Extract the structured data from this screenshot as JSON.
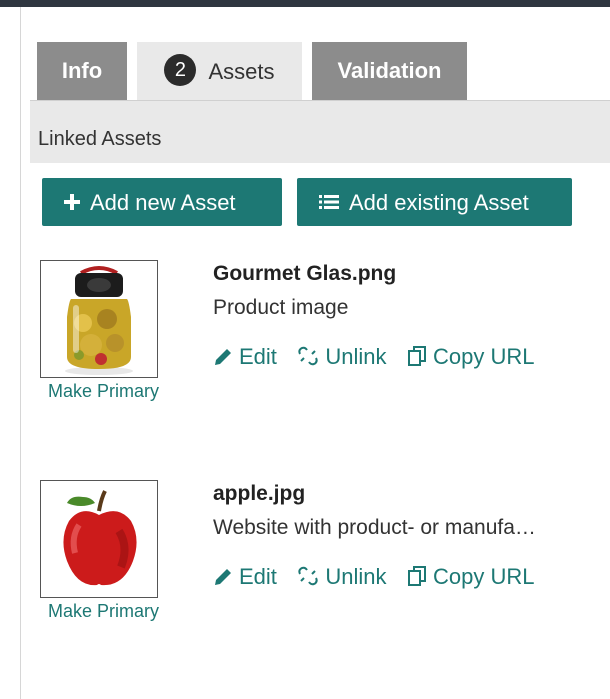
{
  "tabs": {
    "info_label": "Info",
    "assets_count": "2",
    "assets_label": "Assets",
    "validation_label": "Validation"
  },
  "section": {
    "title": "Linked Assets"
  },
  "buttons": {
    "add_new": "Add new Asset",
    "add_existing": "Add existing Asset"
  },
  "assets": [
    {
      "name": "Gourmet Glas.png",
      "description": "Product image",
      "edit": "Edit",
      "unlink": "Unlink",
      "copy_url": "Copy URL",
      "make_primary": "Make Primary",
      "thumbnail_icon": "jar-image"
    },
    {
      "name": "apple.jpg",
      "description": "Website with product- or manufa…",
      "edit": "Edit",
      "unlink": "Unlink",
      "copy_url": "Copy URL",
      "make_primary": "Make Primary",
      "thumbnail_icon": "apple-image"
    }
  ],
  "colors": {
    "accent": "#1d7874",
    "tab_inactive": "#8c8c8c",
    "tab_active": "#e9e9e9",
    "header_bar": "#2f3640"
  }
}
